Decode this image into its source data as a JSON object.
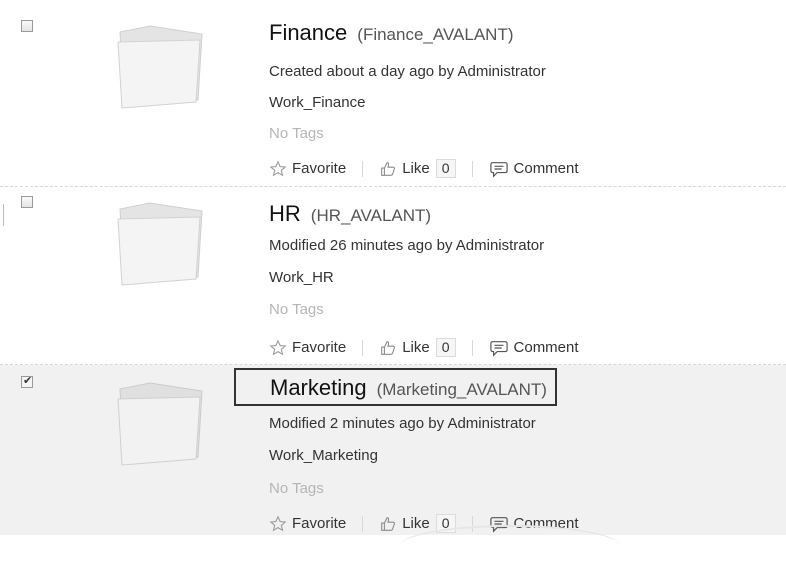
{
  "items": [
    {
      "name": "Finance",
      "system_name": "(Finance_AVALANT)",
      "meta": "Created about a day ago by Administrator",
      "space": "Work_Finance",
      "tags": "No Tags",
      "checked": false,
      "actions": {
        "favorite": "Favorite",
        "like": "Like",
        "like_count": "0",
        "comment": "Comment"
      }
    },
    {
      "name": "HR",
      "system_name": "(HR_AVALANT)",
      "meta": "Modified 26 minutes ago by Administrator",
      "space": "Work_HR",
      "tags": "No Tags",
      "checked": false,
      "actions": {
        "favorite": "Favorite",
        "like": "Like",
        "like_count": "0",
        "comment": "Comment"
      }
    },
    {
      "name": "Marketing",
      "system_name": "(Marketing_AVALANT)",
      "meta": "Modified 2 minutes ago by Administrator",
      "space": "Work_Marketing",
      "tags": "No Tags",
      "checked": true,
      "actions": {
        "favorite": "Favorite",
        "like": "Like",
        "like_count": "0",
        "comment": "Comment"
      }
    }
  ],
  "icons": {
    "checkbox": "checkbox-icon",
    "folder": "folder-icon",
    "favorite": "star-outline-icon",
    "like": "thumbs-up-icon",
    "comment": "speech-bubble-icon"
  },
  "colors": {
    "selected_row_bg": "#f1f1f1",
    "tag_text": "#b5b5b5",
    "separator": "#d8d8d8"
  }
}
